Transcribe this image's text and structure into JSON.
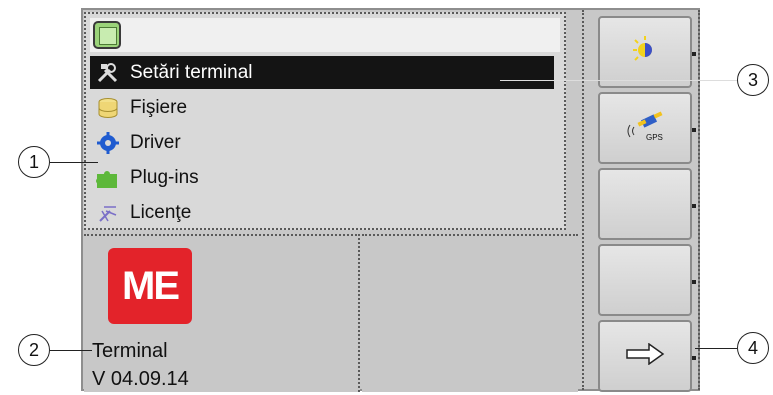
{
  "menu": {
    "items": [
      {
        "label": "Setări terminal",
        "icon": "tools-icon",
        "selected": true
      },
      {
        "label": "Fişiere",
        "icon": "database-icon",
        "selected": false
      },
      {
        "label": "Driver",
        "icon": "gear-icon",
        "selected": false
      },
      {
        "label": "Plug-ins",
        "icon": "puzzle-icon",
        "selected": false
      },
      {
        "label": "Licenţe",
        "icon": "license-icon",
        "selected": false
      }
    ]
  },
  "info": {
    "logo_text": "ME",
    "terminal": "Terminal",
    "version": "V 04.09.14"
  },
  "softkeys": [
    {
      "name": "brightness-button",
      "icon": "brightness-icon"
    },
    {
      "name": "gps-button",
      "icon": "gps-icon",
      "text": "GPS"
    },
    {
      "name": "empty-button-1",
      "icon": ""
    },
    {
      "name": "empty-button-2",
      "icon": ""
    },
    {
      "name": "next-button",
      "icon": "arrow-right-icon"
    }
  ],
  "callouts": [
    "1",
    "2",
    "3",
    "4"
  ],
  "colors": {
    "logo": "#e3232a",
    "selected_bg": "#141414",
    "panel": "#d9d9d9"
  }
}
